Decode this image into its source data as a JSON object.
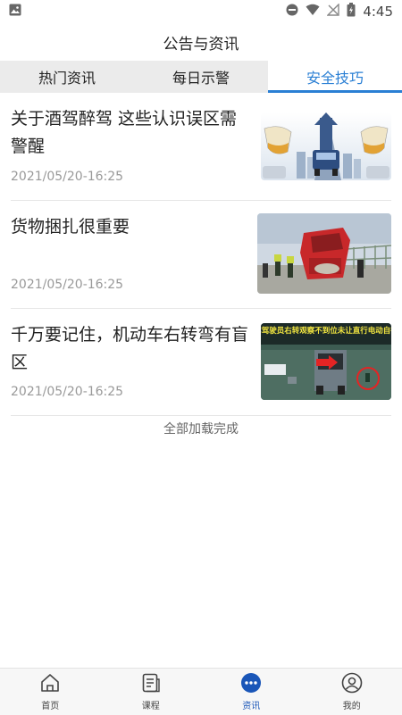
{
  "status_bar": {
    "time": "4:45"
  },
  "header": {
    "title": "公告与资讯"
  },
  "tabs": [
    {
      "label": "热门资讯",
      "active": false
    },
    {
      "label": "每日示警",
      "active": false
    },
    {
      "label": "安全技巧",
      "active": true
    }
  ],
  "articles": [
    {
      "title": "关于酒驾醉驾 这些认识误区需警醒",
      "date": "2021/05/20-16:25",
      "image": "drunk-driving-illustration"
    },
    {
      "title": "货物捆扎很重要",
      "date": "2021/05/20-16:25",
      "image": "truck-accident-photo"
    },
    {
      "title": "千万要记住，机动车右转弯有盲区",
      "date": "2021/05/20-16:25",
      "image": "right-turn-blind-spot-photo",
      "image_text": "货车驾驶员右转观察不到位未让直行电动自行车"
    }
  ],
  "footer_note": "全部加载完成",
  "bottom_nav": [
    {
      "label": "首页",
      "icon": "home-icon",
      "active": false
    },
    {
      "label": "课程",
      "icon": "course-icon",
      "active": false
    },
    {
      "label": "资讯",
      "icon": "chat-bubble-icon",
      "active": true
    },
    {
      "label": "我的",
      "icon": "user-icon",
      "active": false
    }
  ],
  "colors": {
    "accent": "#2a7fd4",
    "nav_active": "#1a56b8",
    "tab_bar_bg": "#ebebeb"
  }
}
